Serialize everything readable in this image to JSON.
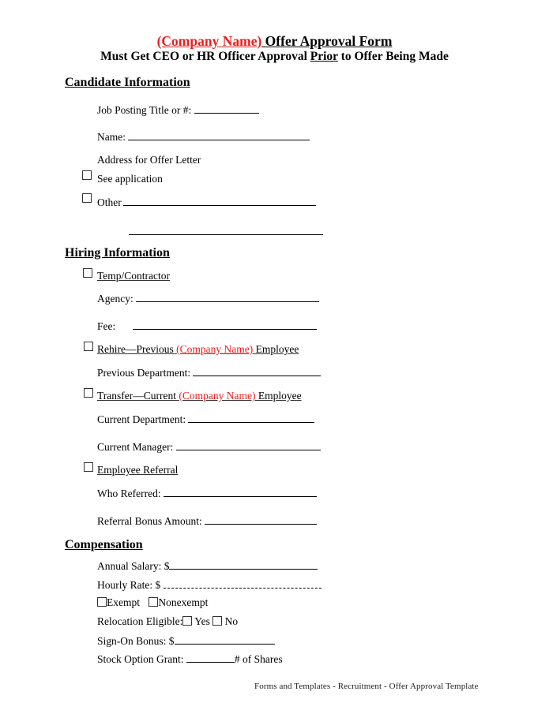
{
  "header": {
    "company_placeholder": "(Company Name)",
    "title_rest": " Offer  Approval Form",
    "subtitle_pre": "Must Get CEO or HR Officer Approval ",
    "subtitle_emph": "Prior",
    "subtitle_post": " to Offer Being Made"
  },
  "candidate": {
    "heading": "Candidate Information",
    "job_posting_label": "Job Posting Title  or #:",
    "name_label": "Name:",
    "address_label": "Address for Offer Letter",
    "see_application_label": "See application",
    "other_label": "Other"
  },
  "hiring": {
    "heading": "Hiring Information",
    "temp_label": "Temp/Contractor",
    "agency_label": "Agency:",
    "fee_label": "Fee:",
    "rehire_pre": "Rehire—Previous ",
    "rehire_company": "(Company Name)",
    "rehire_post": " Employee",
    "previous_department_label": "Previous Department:",
    "transfer_pre": "Transfer—Current ",
    "transfer_company": "(Company Name)",
    "transfer_post": " Employee",
    "current_department_label": "Current Department:",
    "current_manager_label": "Current Manager:",
    "referral_label": "Employee Referral",
    "who_referred_label": "Who Referred:",
    "referral_bonus_label": "Referral Bonus Amount:"
  },
  "compensation": {
    "heading": "Compensation",
    "annual_salary_label": "Annual Salary: $",
    "hourly_rate_label": "Hourly Rate: $",
    "exempt_label": "Exempt",
    "nonexempt_label": "Nonexempt",
    "relocation_label": "Relocation Eligible:",
    "yes_label": "Yes",
    "no_label": "No",
    "sign_on_label": "Sign-On Bonus: $",
    "stock_option_label": "Stock Option Grant:",
    "shares_label": "# of Shares"
  },
  "footer": {
    "text": "Forms and Templates - Recruitment - Offer Approval Template"
  }
}
